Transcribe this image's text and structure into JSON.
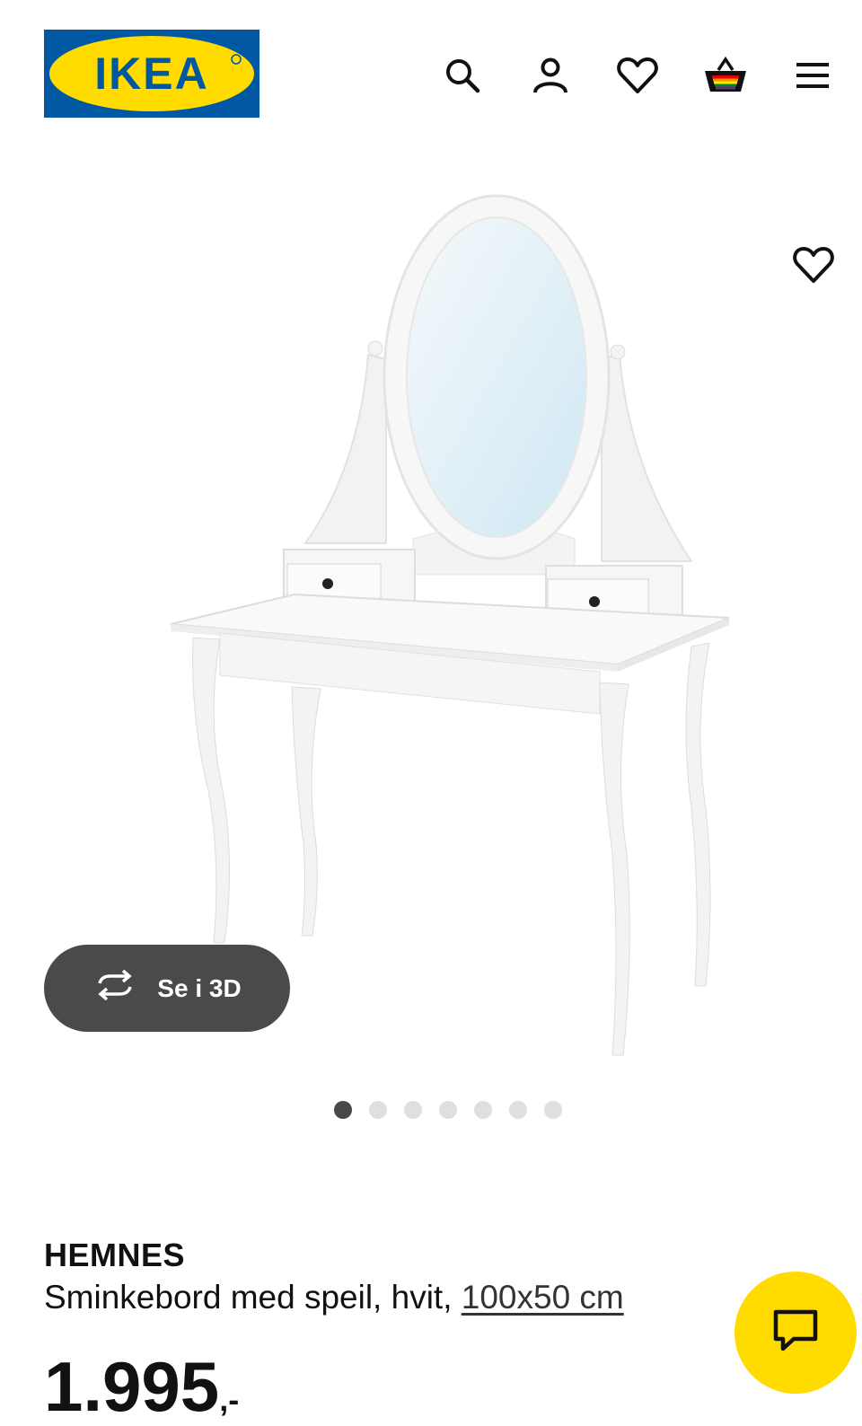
{
  "brand": {
    "logo_text": "IKEA",
    "primary_color": "#0058a3",
    "accent_color": "#ffdb00"
  },
  "header": {
    "icons": [
      "search-icon",
      "account-icon",
      "favorites-icon",
      "cart-icon",
      "menu-icon"
    ]
  },
  "gallery": {
    "view_3d_label": "Se i 3D",
    "image_count": 7,
    "active_index": 0
  },
  "product": {
    "name": "HEMNES",
    "description": "Sminkebord med speil, hvit, ",
    "size": "100x50 cm",
    "price": "1.995",
    "price_suffix": ",-"
  },
  "chat": {
    "icon": "chat-icon"
  }
}
